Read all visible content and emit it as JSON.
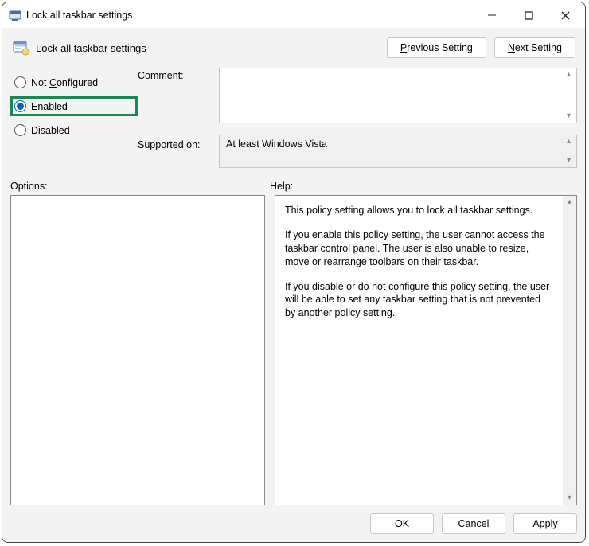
{
  "window": {
    "title": "Lock all taskbar settings"
  },
  "header": {
    "title": "Lock all taskbar settings",
    "previous_button": "Previous Setting",
    "next_button": "Next Setting"
  },
  "state_radios": {
    "not_configured": "Not Configured",
    "enabled": "Enabled",
    "disabled": "Disabled",
    "selected": "enabled"
  },
  "fields": {
    "comment_label": "Comment:",
    "comment_value": "",
    "supported_label": "Supported on:",
    "supported_value": "At least Windows Vista"
  },
  "sections": {
    "options_label": "Options:",
    "help_label": "Help:"
  },
  "help": {
    "p1": "This policy setting allows you to lock all taskbar settings.",
    "p2": "If you enable this policy setting, the user cannot access the taskbar control panel. The user is also unable to resize, move or rearrange toolbars on their taskbar.",
    "p3": "If you disable or do not configure this policy setting, the user will be able to set any taskbar setting that is not prevented by another policy setting."
  },
  "footer": {
    "ok": "OK",
    "cancel": "Cancel",
    "apply": "Apply"
  },
  "highlight_color": "#178a53"
}
